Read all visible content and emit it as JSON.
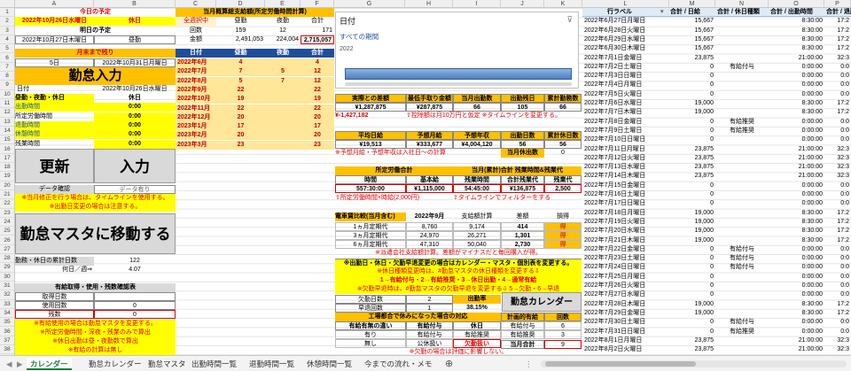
{
  "columns": [
    "A",
    "B",
    "C",
    "D",
    "E",
    "F",
    "G",
    "H",
    "I",
    "J",
    "K",
    "L",
    "M",
    "N",
    "O",
    "P"
  ],
  "rows": [
    "1",
    "2",
    "3",
    "4",
    "5",
    "6",
    "7",
    "8",
    "9",
    "10",
    "11",
    "12",
    "13",
    "14",
    "15",
    "16",
    "17",
    "18",
    "19",
    "20",
    "21",
    "22",
    "23",
    "24",
    "25",
    "26",
    "27",
    "28",
    "29",
    "30",
    "31",
    "32",
    "33",
    "34",
    "35",
    "36",
    "37",
    "38"
  ],
  "left": {
    "today_label": "今日の予定",
    "today_date": "2022年10月26日水曜日",
    "today_status": "休日",
    "tomorrow_label": "明日の予定",
    "tomorrow_date": "2022年10月27日木曜日",
    "tomorrow_status": "昼勤",
    "month_end_label": "月末まで残り",
    "days_left": "5日",
    "month_end_date": "2022年10月31日月曜日",
    "kintai_title": "勤怠入力",
    "date_label": "日付",
    "date_value": "2022年10月26日水曜日",
    "shift_label": "昼勤・夜勤・休日",
    "shift_value": "休日",
    "out_label": "出勤時間",
    "out_value": "0:00",
    "ot_label": "所定労働時間",
    "ot_value": "0:00",
    "leave_label": "退勤時間",
    "leave_value": "0:00",
    "rest_label": "休憩時間",
    "rest_value": "0:00",
    "over_label": "残業時間",
    "over_value": "0:00",
    "btn_update": "更新",
    "btn_input": "入力",
    "data_check_label": "データ確認",
    "data_check_value": "データ有り",
    "note1": "※当月修正を行う場合は、タイムラインを使用する。",
    "note2": "※出勤日変更の場合は注意する。",
    "btn_master": "勤怠マスタに移動する",
    "workdays_label": "勤務・休日の累計日数",
    "workdays_value": "122",
    "weekly_label": "何日／週⇒",
    "weekly_value": "4.07",
    "paid_title": "有給取得・使用・残数確認表",
    "paid_get_label": "取得日数",
    "paid_get_value": "",
    "paid_use_label": "使用回数",
    "paid_use_value": "0",
    "paid_left_label": "残数",
    "paid_left_value": "0",
    "note3": "※有給使用の場合は勤怠マスタを変更する。",
    "note4": "※所定労働時間・深夜・残業のみで算出",
    "note5": "※休日出勤は昼・夜勤数で算出",
    "note6": "※有給の計算は無し"
  },
  "salary": {
    "title": "当月概算総支給額(所定労働時間計算)",
    "head": [
      "全週択中",
      "昼勤",
      "夜勤",
      "合計"
    ],
    "count": [
      "回数",
      "159",
      "12",
      "171"
    ],
    "amount": [
      "金額",
      "2,491,053",
      "224,004",
      "2,715,057"
    ],
    "sub_head": [
      "日付",
      "昼勤",
      "夜勤",
      "合計"
    ],
    "rows": [
      [
        "2022年6月",
        "4",
        "",
        "4"
      ],
      [
        "2022年7月",
        "7",
        "5",
        "12"
      ],
      [
        "2022年8月",
        "5",
        "7",
        "12"
      ],
      [
        "2022年9月",
        "22",
        "",
        "22"
      ],
      [
        "2022年10月",
        "19",
        "",
        "19"
      ],
      [
        "2022年11月",
        "22",
        "",
        "22"
      ],
      [
        "2022年12月",
        "20",
        "",
        "20"
      ],
      [
        "2023年1月",
        "17",
        "",
        "17"
      ],
      [
        "2023年2月",
        "20",
        "",
        "20"
      ],
      [
        "2023年3月",
        "23",
        "",
        "23"
      ]
    ]
  },
  "slicer": {
    "title": "日付",
    "period": "すべての期間",
    "year": "2022"
  },
  "mid": {
    "r1_head": [
      "実際との差額",
      "最低手取り金額",
      "当月出勤数",
      "出勤残日",
      "累計勤務数"
    ],
    "r1_vals": [
      "¥1,287,875",
      "¥287,875",
      "66",
      "105",
      "66"
    ],
    "r1_neg": "¥-1,427,182",
    "r1_note": "⇧控除額は月10万円と仮定 ※タイムラインを変更する。",
    "r2_head": [
      "平均日給",
      "予想月給",
      "予想年収",
      "出勤日数",
      "累計休日数"
    ],
    "r2_vals": [
      "¥19,513",
      "¥333,677",
      "¥4,004,120",
      "56",
      "56"
    ],
    "r2_note": "※予想月給・予想年収は入社日～の計算",
    "r2_hol_label": "当月休出数",
    "r2_hol_value": "0",
    "r3_title": "所定労働合計",
    "r3_title2": "当月(累計)合計 残業時間&残業代",
    "r3_head": [
      "時間",
      "基本給",
      "残業時間",
      "合計残業代",
      "残業代"
    ],
    "r3_vals": [
      "557:30:00",
      "¥1,115,000",
      "54:45:00",
      "¥136,875",
      "2,500"
    ],
    "r3_note1": "⇧所定労働時間×時給(2,000円)",
    "r3_note2": "⇧タイムラインでフィルターをする",
    "r4_title": "電車賃比較(当月含む)",
    "r4_month": "2022年9月",
    "r4_head": [
      "支給額計算",
      "差額",
      "損得"
    ],
    "r4_rows": [
      [
        "1ヵ月定期代",
        "8,760",
        "9,174",
        "414",
        "得"
      ],
      [
        "3ヵ月定期代",
        "24,970",
        "26,271",
        "1,301",
        "得"
      ],
      [
        "6ヵ月定期代",
        "47,310",
        "50,040",
        "2,730",
        "得"
      ]
    ],
    "r4_note": "※派遣会社支給額計算。差額がマイナスだと毎回購入が得。",
    "r5_note1": "※出勤日・休日・欠勤早退変更の場合はカレンダー・マスタ・個別表を変更する。",
    "r5_note2": "※休日種類変更時は、#勤怠マスタの休日種類を変更する⇩",
    "r5_note3": "1→有給付与・2→有給推奨・3→休日出勤・4→通常有給",
    "r5_note4": "※欠勤早退時は、#勤怠マスタの欠勤早退を変更する⇩ 5→欠勤・6→早退",
    "abs_label": "欠勤日数",
    "abs_value": "2",
    "early_label": "早退回数",
    "early_value": "1",
    "rate_label": "出勤率",
    "rate_value": "38.15%",
    "btn_calendar": "勤怠カレンダー",
    "fac_title": "工場都合で休みになった場合の対応",
    "fac_head": [
      "有給有無の違い",
      "有給付与",
      "休日",
      "計画的有給",
      "回数"
    ],
    "fac_rows": [
      [
        "有り",
        "有給付与",
        "有給推奨",
        "有給付与",
        "6"
      ],
      [
        "無し",
        "公休扱い",
        "欠勤扱い",
        "有給推奨",
        "3"
      ]
    ],
    "fac_total_label": "当月合計",
    "fac_total_value": "9",
    "fac_note": "※欠勤の場合は評価に影響しない。"
  },
  "pivot": {
    "head": [
      "行ラベル",
      "合計 / 日給",
      "合計 / 休日種類",
      "合計 / 出勤時間",
      "合計 / 退勤"
    ],
    "rows": [
      [
        "2022年6月27日月曜日",
        "15,667",
        "",
        "8:30:00",
        "17:2"
      ],
      [
        "2022年6月28日火曜日",
        "15,667",
        "",
        "8:30:00",
        "17:2"
      ],
      [
        "2022年6月29日水曜日",
        "15,667",
        "",
        "8:30:00",
        "17:2"
      ],
      [
        "2022年6月30日木曜日",
        "15,667",
        "",
        "8:30:00",
        "17:2"
      ],
      [
        "2022年7月1日金曜日",
        "23,875",
        "",
        "21:00:00",
        "32:3"
      ],
      [
        "2022年7月2日土曜日",
        "0",
        "有給付与",
        "0:00:00",
        "0:0"
      ],
      [
        "2022年7月3日日曜日",
        "0",
        "",
        "0:00:00",
        "0:0"
      ],
      [
        "2022年7月4日月曜日",
        "0",
        "",
        "0:00:00",
        "0:0"
      ],
      [
        "2022年7月5日火曜日",
        "0",
        "",
        "0:00:00",
        "0:0"
      ],
      [
        "2022年7月6日水曜日",
        "19,000",
        "",
        "8:30:00",
        "17:2"
      ],
      [
        "2022年7月7日木曜日",
        "19,000",
        "",
        "8:30:00",
        "17:2"
      ],
      [
        "2022年7月8日金曜日",
        "0",
        "有給推奨",
        "0:00:00",
        "0:0"
      ],
      [
        "2022年7月9日土曜日",
        "0",
        "有給推奨",
        "0:00:00",
        "0:0"
      ],
      [
        "2022年7月10日日曜日",
        "0",
        "",
        "0:00:00",
        "0:0"
      ],
      [
        "2022年7月11日月曜日",
        "23,875",
        "",
        "21:00:00",
        "32:3"
      ],
      [
        "2022年7月12日火曜日",
        "23,875",
        "",
        "21:00:00",
        "32:3"
      ],
      [
        "2022年7月13日水曜日",
        "23,875",
        "",
        "21:00:00",
        "32:3"
      ],
      [
        "2022年7月14日木曜日",
        "23,875",
        "",
        "21:00:00",
        "32:3"
      ],
      [
        "2022年7月15日金曜日",
        "0",
        "",
        "0:00:00",
        "0:0"
      ],
      [
        "2022年7月16日土曜日",
        "0",
        "",
        "0:00:00",
        "0:0"
      ],
      [
        "2022年7月17日日曜日",
        "0",
        "",
        "0:00:00",
        "0:0"
      ],
      [
        "2022年7月18日月曜日",
        "19,000",
        "",
        "8:30:00",
        "17:2"
      ],
      [
        "2022年7月19日火曜日",
        "19,000",
        "",
        "8:30:00",
        "17:2"
      ],
      [
        "2022年7月20日水曜日",
        "19,000",
        "",
        "8:30:00",
        "17:2"
      ],
      [
        "2022年7月21日木曜日",
        "19,000",
        "",
        "8:30:00",
        "17:2"
      ],
      [
        "2022年7月22日金曜日",
        "0",
        "有給付与",
        "0:00:00",
        "0:0"
      ],
      [
        "2022年7月23日土曜日",
        "0",
        "有給付与",
        "0:00:00",
        "0:0"
      ],
      [
        "2022年7月24日日曜日",
        "0",
        "有給付与",
        "0:00:00",
        "0:0"
      ],
      [
        "2022年7月25日月曜日",
        "0",
        "",
        "0:00:00",
        "0:0"
      ],
      [
        "2022年7月26日火曜日",
        "0",
        "",
        "0:00:00",
        "0:0"
      ],
      [
        "2022年7月27日水曜日",
        "0",
        "",
        "0:00:00",
        "0:0"
      ],
      [
        "2022年7月28日木曜日",
        "19,000",
        "",
        "8:30:00",
        "17:2"
      ],
      [
        "2022年7月29日金曜日",
        "19,000",
        "",
        "8:30:00",
        "17:2"
      ],
      [
        "2022年7月30日土曜日",
        "0",
        "有給付与",
        "0:00:00",
        "0:0"
      ],
      [
        "2022年7月31日日曜日",
        "0",
        "有給推奨",
        "0:00:00",
        "0:0"
      ],
      [
        "2022年8月1日月曜日",
        "23,875",
        "",
        "21:00:00",
        "32:3"
      ],
      [
        "2022年8月2日火曜日",
        "23,875",
        "",
        "21:00:00",
        "32:3"
      ]
    ]
  },
  "tabs": [
    "カレンダー",
    "勤怠カレンダー",
    "勤怠マスタ",
    "出勤時間一覧",
    "退勤時間一覧",
    "休憩時間一覧",
    "今までの流れ・メモ"
  ]
}
